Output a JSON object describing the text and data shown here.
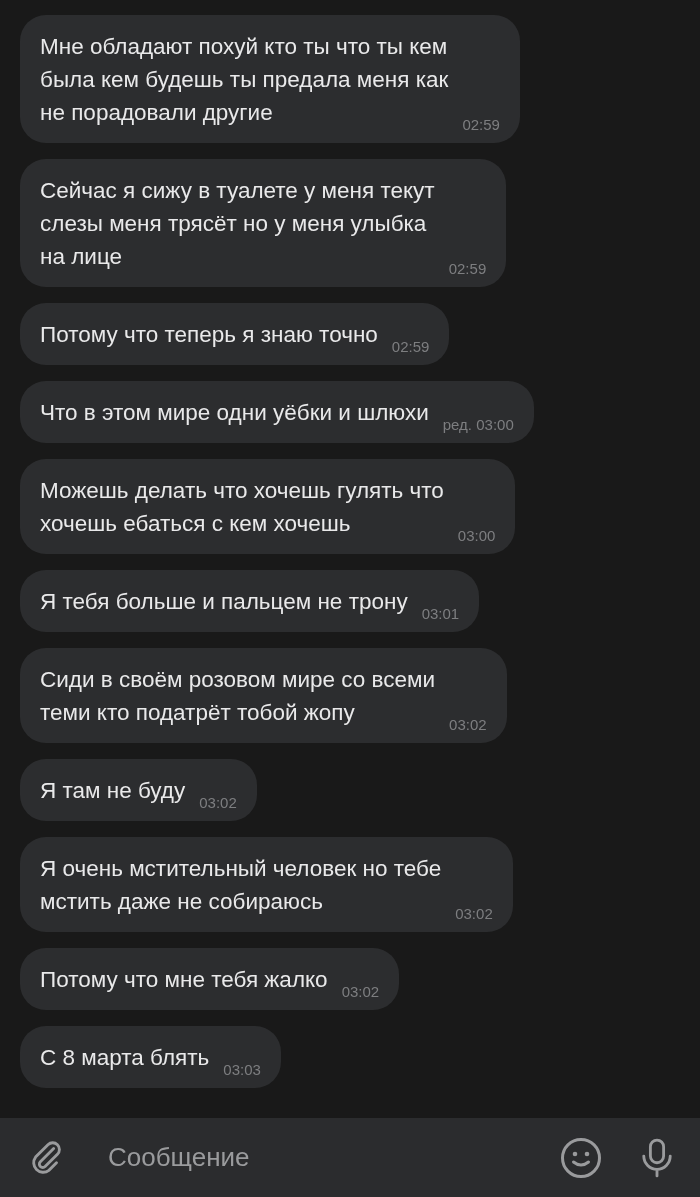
{
  "messages": [
    {
      "lines": [
        "Мне обладают похуй кто ты что ты кем",
        "была кем будешь ты предала меня как",
        "не порадовали другие"
      ],
      "time": "02:59"
    },
    {
      "lines": [
        "Сейчас я сижу в туалете у меня текут",
        "слезы меня трясёт но у меня улыбка",
        "на лице"
      ],
      "time": "02:59"
    },
    {
      "lines": [
        "Потому что теперь я знаю точно"
      ],
      "time": "02:59"
    },
    {
      "lines": [
        "Что в этом мире одни уёбки и шлюхи"
      ],
      "time": "ред. 03:00"
    },
    {
      "lines": [
        "Можешь делать что хочешь гулять что",
        "хочешь ебаться с кем хочешь"
      ],
      "time": "03:00"
    },
    {
      "lines": [
        "Я тебя больше и пальцем не трону"
      ],
      "time": "03:01"
    },
    {
      "lines": [
        "Сиди в своём розовом мире со всеми",
        "теми кто податрёт тобой жопу"
      ],
      "time": "03:02"
    },
    {
      "lines": [
        "Я там не буду"
      ],
      "time": "03:02"
    },
    {
      "lines": [
        "Я очень мстительный человек но тебе",
        "мстить даже не собираюсь"
      ],
      "time": "03:02"
    },
    {
      "lines": [
        "Потому что мне тебя жалко"
      ],
      "time": "03:02"
    },
    {
      "lines": [
        "С 8 марта блять"
      ],
      "time": "03:03"
    }
  ],
  "composer": {
    "placeholder": "Сообщение"
  }
}
